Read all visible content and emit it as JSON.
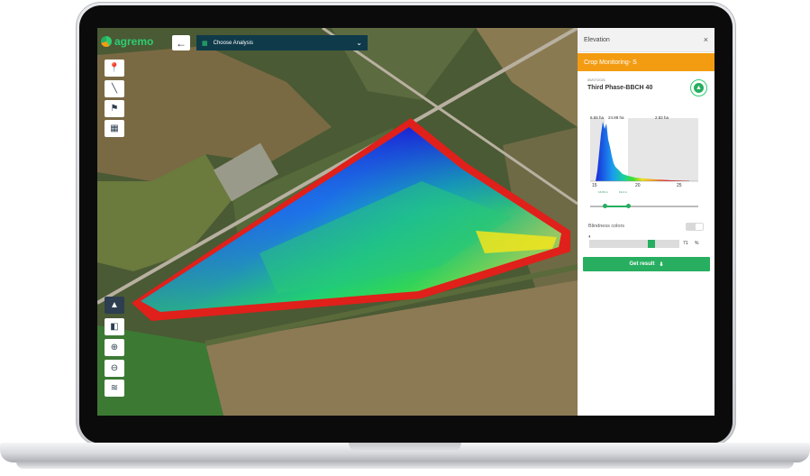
{
  "app": {
    "logo_text": "agremo",
    "back_label": "←",
    "analysis_select": {
      "icon": "grid-icon",
      "value": "Choose Analysis"
    }
  },
  "toolbar_top": [
    {
      "name": "marker-tool",
      "icon": "map-pin-icon",
      "glyph": "📍"
    },
    {
      "name": "measure-tool",
      "icon": "ruler-icon",
      "glyph": "╲"
    },
    {
      "name": "flag-tool",
      "icon": "flag-icon",
      "glyph": "⚑"
    },
    {
      "name": "area-tool",
      "icon": "area-select-icon",
      "glyph": "▦"
    }
  ],
  "toolbar_bottom": [
    {
      "name": "elevation-tool",
      "icon": "mountain-icon",
      "glyph": "▲"
    },
    {
      "name": "field-tool",
      "icon": "field-icon",
      "glyph": "◧"
    },
    {
      "name": "zoom-in-tool",
      "icon": "zoom-in-icon",
      "glyph": "⊕"
    },
    {
      "name": "zoom-out-tool",
      "icon": "zoom-out-icon",
      "glyph": "⊖"
    },
    {
      "name": "layers-tool",
      "icon": "layers-icon",
      "glyph": "≋"
    }
  ],
  "panel": {
    "title": "Elevation",
    "close": "×",
    "crop_label": "Crop Monitoring- S",
    "date": "05/07/2021",
    "phase": "Third Phase-BBCH 40",
    "badge_glyph": "▲",
    "histogram": {
      "left_area": "6.55 ha",
      "mid_area": "24.88 ha",
      "right_area": "2.82 ha",
      "ticks": [
        "15",
        "20",
        "25"
      ],
      "range_low_label": "16.80 m",
      "range_high_label": "19.2 m"
    },
    "blindness_label": "Blindness colors",
    "opacity_icon": "contrast-icon",
    "opacity_glyph": "◐",
    "opacity": {
      "value": "71",
      "unit": "%"
    },
    "opacity_level": 0.71,
    "button_label": "Get result",
    "button_icon": "download-icon",
    "button_glyph": "⬇"
  },
  "colors": {
    "accent_orange": "#f39c12",
    "primary_green": "#27ae60",
    "header_navy": "#0f3a4a"
  }
}
